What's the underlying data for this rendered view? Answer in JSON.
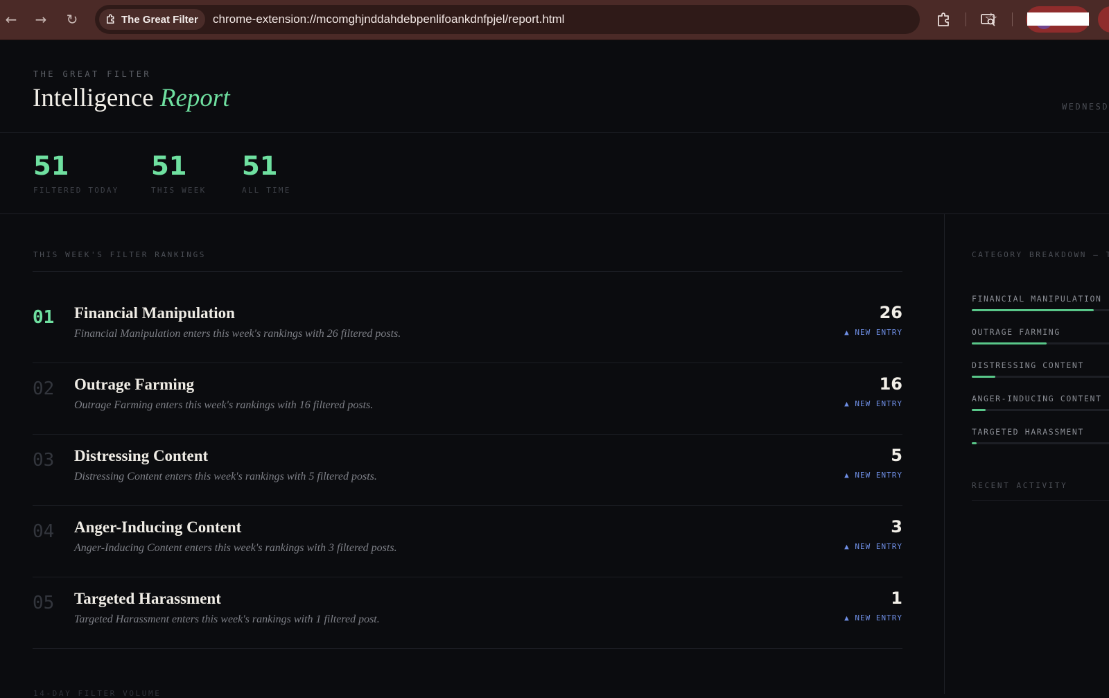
{
  "browser": {
    "back_icon": "back-arrow-icon",
    "forward_icon": "forward-arrow-icon",
    "reload_icon": "reload-icon",
    "site_chip_label": "The Great Filter",
    "url": "chrome-extension://mcomghjnddahdebpenlifoankdnfpjel/report.html"
  },
  "header": {
    "eyebrow": "THE GREAT FILTER",
    "title_main": "Intelligence",
    "title_accent": "Report",
    "date_label": "WEDNESDA"
  },
  "stats": [
    {
      "value": "51",
      "label": "FILTERED TODAY"
    },
    {
      "value": "51",
      "label": "THIS WEEK"
    },
    {
      "value": "51",
      "label": "ALL TIME"
    }
  ],
  "rankings": {
    "section_label": "THIS WEEK'S FILTER RANKINGS",
    "items": [
      {
        "rank": "01",
        "name": "Financial Manipulation",
        "description": "Financial Manipulation enters this week's rankings with 26 filtered posts.",
        "count": "26",
        "badge": "▲ NEW ENTRY"
      },
      {
        "rank": "02",
        "name": "Outrage Farming",
        "description": "Outrage Farming enters this week's rankings with 16 filtered posts.",
        "count": "16",
        "badge": "▲ NEW ENTRY"
      },
      {
        "rank": "03",
        "name": "Distressing Content",
        "description": "Distressing Content enters this week's rankings with 5 filtered posts.",
        "count": "5",
        "badge": "▲ NEW ENTRY"
      },
      {
        "rank": "04",
        "name": "Anger-Inducing Content",
        "description": "Anger-Inducing Content enters this week's rankings with 3 filtered posts.",
        "count": "3",
        "badge": "▲ NEW ENTRY"
      },
      {
        "rank": "05",
        "name": "Targeted Harassment",
        "description": "Targeted Harassment enters this week's rankings with 1 filtered post.",
        "count": "1",
        "badge": "▲ NEW ENTRY"
      }
    ]
  },
  "breakdown": {
    "section_label": "CATEGORY BREAKDOWN — TH",
    "items": [
      {
        "label": "FINANCIAL MANIPULATION",
        "fraction": 1.0
      },
      {
        "label": "OUTRAGE FARMING",
        "fraction": 0.615
      },
      {
        "label": "DISTRESSING CONTENT",
        "fraction": 0.192
      },
      {
        "label": "ANGER-INDUCING CONTENT",
        "fraction": 0.115
      },
      {
        "label": "TARGETED HARASSMENT",
        "fraction": 0.04
      }
    ],
    "accent_color": "#59c789"
  },
  "recent_activity_label": "RECENT ACTIVITY",
  "footer_peek": "14-DAY FILTER VOLUME",
  "colors": {
    "background": "#0b0c0f",
    "accent_green": "#6fe0a0",
    "badge_blue": "#6f8fe6",
    "chrome_bar": "#4b2a27"
  }
}
